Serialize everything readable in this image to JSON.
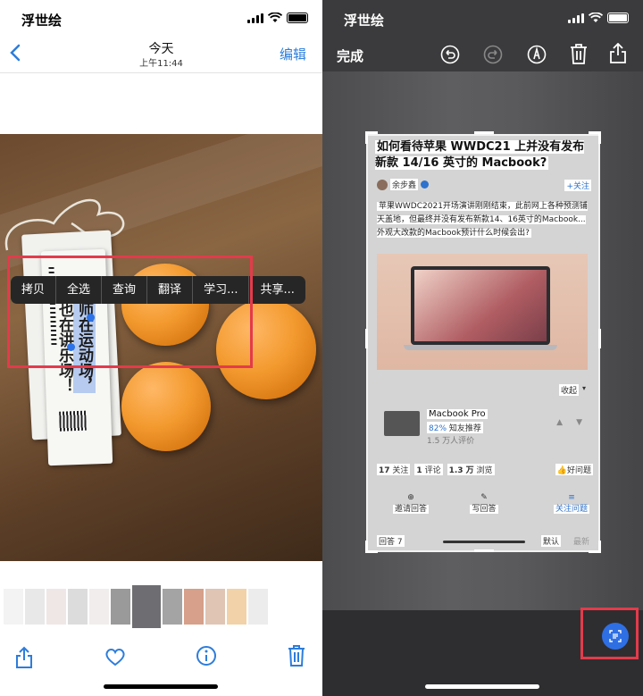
{
  "left": {
    "status": {
      "app": "浮世绘"
    },
    "nav": {
      "title": "今天",
      "subtitle": "上午11:44",
      "edit": "编辑"
    },
    "photo_text": {
      "line1": "师在运动场，",
      "line2": "也在讲乐场！"
    },
    "context_menu": [
      "拷贝",
      "全选",
      "查询",
      "翻译",
      "学习...",
      "共享..."
    ],
    "toolbar": {
      "icons": [
        "share-icon",
        "heart-icon",
        "info-icon",
        "trash-icon"
      ]
    }
  },
  "right": {
    "status": {
      "app": "浮世绘"
    },
    "bar": {
      "done": "完成",
      "icons": [
        "undo-icon",
        "redo-icon",
        "markup-icon",
        "trash-icon",
        "share-icon"
      ]
    },
    "doc": {
      "question": "如何看待苹果 WWDC21 上并没有发布新款 14/16 英寸的 Macbook?",
      "author": "余步鑫",
      "follow": "+关注",
      "body": "苹果WWDC2021开场演讲刚刚结束，此前网上各种预测铺天盖地，但最终并没有发布新款14、16英寸的Macbook...外观大改款的Macbook预计什么时候会出?",
      "collapse": "收起",
      "product": {
        "name": "Macbook Pro",
        "recommend_pct": "82%",
        "recommend_label": "知友推荐",
        "reviews": "1.5 万人评价"
      },
      "stats": {
        "a_num": "17",
        "a_label": "关注",
        "b_num": "1",
        "b_label": "评论",
        "c_num": "1.3 万",
        "c_label": "浏览",
        "good_q": "好问题"
      },
      "actions": {
        "invite": "邀请回答",
        "write": "写回答",
        "follow_q": "关注问题"
      },
      "footer": {
        "answers": "回答 7",
        "default": "默认",
        "newest": "最新"
      }
    }
  }
}
